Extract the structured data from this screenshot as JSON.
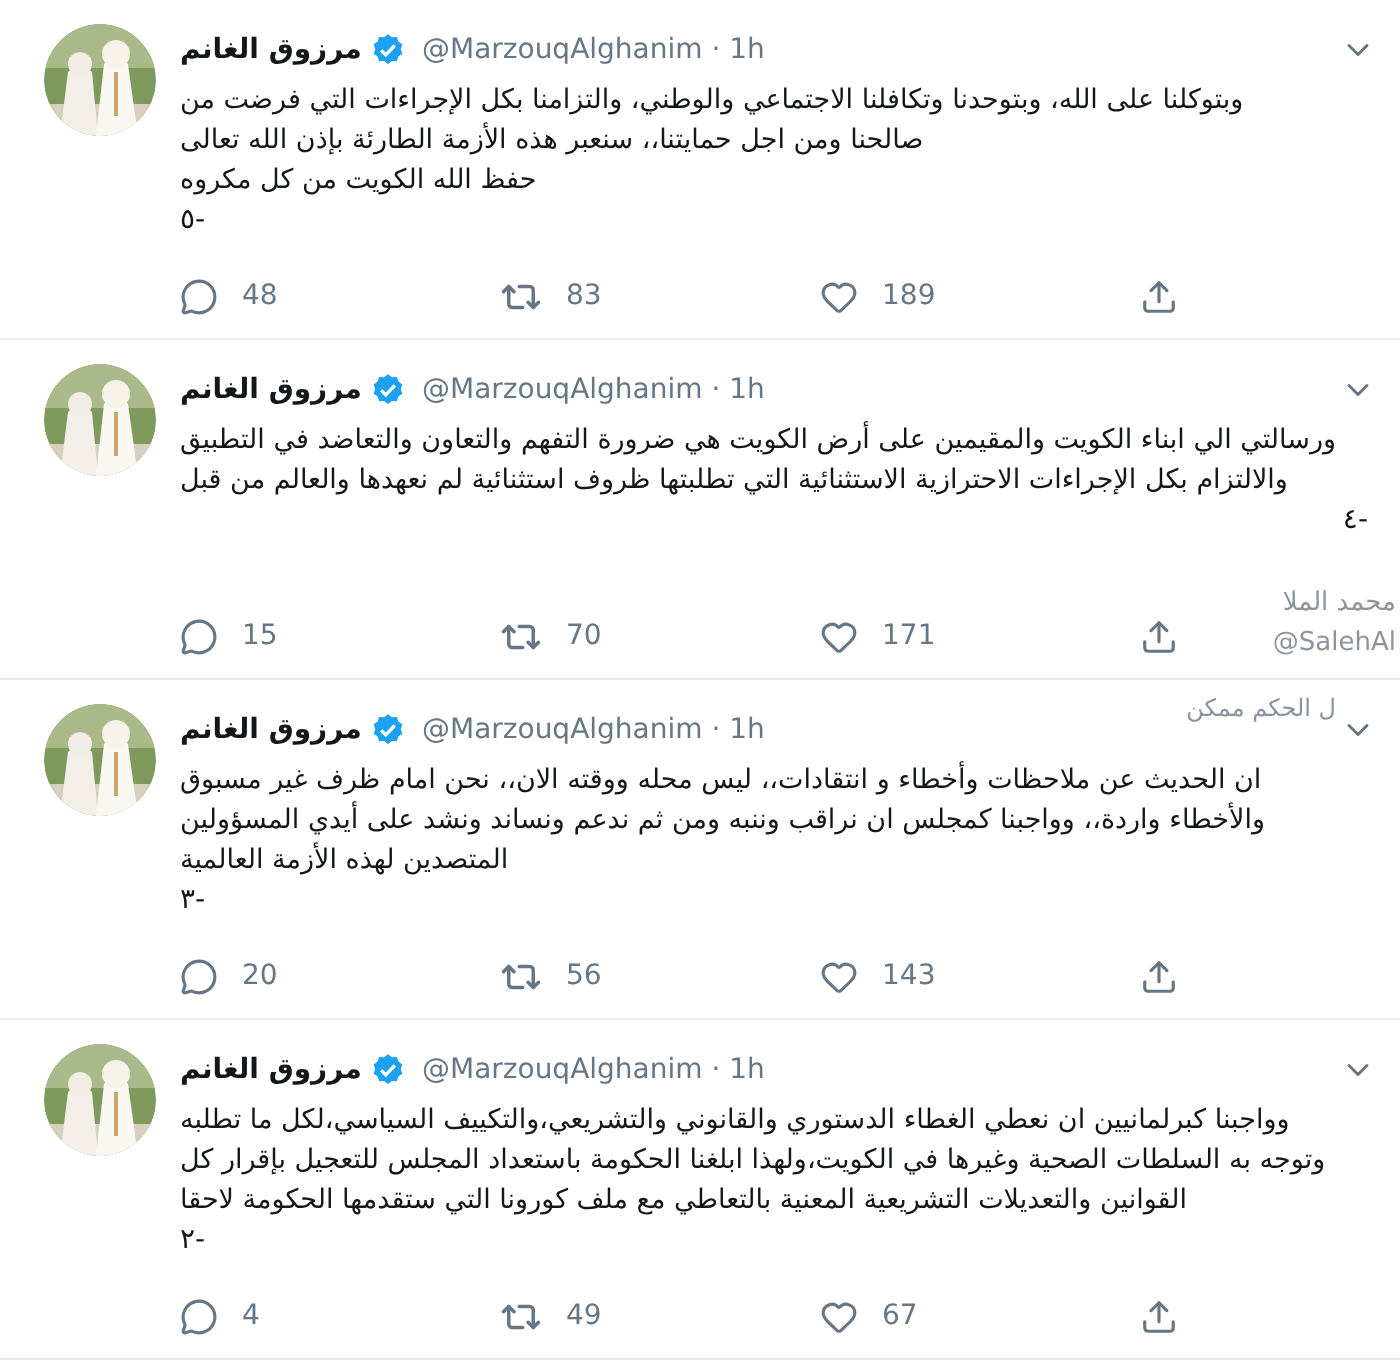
{
  "tweets": [
    {
      "name": "مرزوق الغانم",
      "verified": true,
      "meta": "@MarzouqAlghanim · 1h",
      "text": "وبتوكلنا على الله، وبتوحدنا وتكافلنا الاجتماعي والوطني، والتزامنا بكل الإجراءات التي فرضت من\nصالحنا ومن اجل حمايتنا،، سنعبر هذه الأزمة الطارئة بإذن الله تعالى\nحفظ الله الكويت من كل مكروه",
      "number": "٥-",
      "kind": "leading",
      "replies": "48",
      "retweets": "83",
      "likes": "189"
    },
    {
      "name": "مرزوق الغانم",
      "verified": true,
      "meta": "@MarzouqAlghanim · 1h",
      "text": "ورسالتي الي ابناء الكويت والمقيمين على أرض الكويت هي ضرورة التفهم والتعاون والتعاضد في التطبيق\nوالالتزام بكل الإجراءات الاحترازية الاستثنائية التي تطلبتها ظروف استثنائية لم نعهدها والعالم من قبل",
      "number": "٤-",
      "kind": "trailing",
      "replies": "15",
      "retweets": "70",
      "likes": "171"
    },
    {
      "name": "مرزوق الغانم",
      "verified": true,
      "meta": "@MarzouqAlghanim · 1h",
      "text": "ان الحديث عن ملاحظات وأخطاء و انتقادات،، ليس محله ووقته الان،، نحن امام ظرف غير مسبوق\nوالأخطاء واردة،، وواجبنا كمجلس ان نراقب وننبه ومن ثم ندعم ونساند ونشد على أيدي المسؤولين\nالمتصدين لهذه الأزمة العالمية",
      "number": "٣-",
      "kind": "leading",
      "replies": "20",
      "retweets": "56",
      "likes": "143"
    },
    {
      "name": "مرزوق الغانم",
      "verified": true,
      "meta": "@MarzouqAlghanim · 1h",
      "text": "وواجبنا كبرلمانيين ان نعطي الغطاء الدستوري والقانوني والتشريعي،والتكييف السياسي،لكل ما تطلبه\nوتوجه به السلطات الصحية وغيرها في الكويت،ولهذا ابلغنا الحكومة باستعداد المجلس للتعجيل بإقرار كل\nالقوانين والتعديلات التشريعية المعنية بالتعاطي مع ملف كورونا التي ستقدمها الحكومة لاحقا",
      "number": "٢-",
      "kind": "leading",
      "replies": "4",
      "retweets": "49",
      "likes": "67"
    }
  ],
  "overlay": {
    "name": "محمد الملا",
    "handle": "@SalehAl",
    "snippet": "ل الحكم ممكن"
  }
}
